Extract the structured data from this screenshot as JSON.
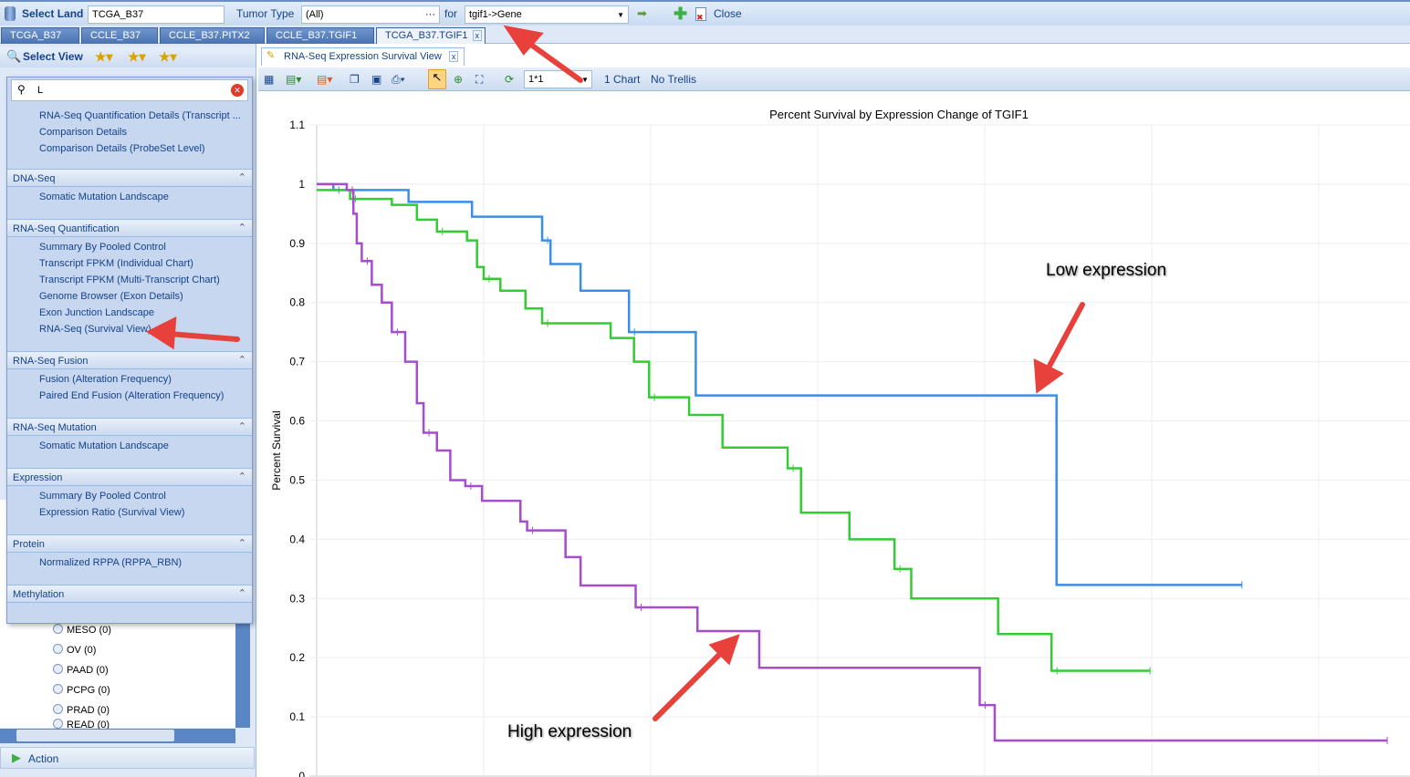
{
  "topbar": {
    "select_land_label": "Select Land",
    "land_value": "TCGA_B37",
    "tumor_type_label": "Tumor Type",
    "tumor_type_value": "(All)",
    "more": "···",
    "for_label": "for",
    "gene_value": "tgif1->Gene",
    "close_label": "Close"
  },
  "tabs": [
    {
      "label": "TCGA_B37"
    },
    {
      "label": "CCLE_B37"
    },
    {
      "label": "CCLE_B37.PITX2"
    },
    {
      "label": "CCLE_B37.TGIF1"
    },
    {
      "label": "TCGA_B37.TGIF1",
      "active": true
    }
  ],
  "left": {
    "select_view_label": "Select View",
    "search_value": "L",
    "top_items": [
      "RNA-Seq Quantification Details (Transcript ...",
      "Comparison Details",
      "Comparison Details (ProbeSet Level)"
    ],
    "sections": [
      {
        "title": "DNA-Seq",
        "items": [
          "Somatic Mutation Landscape"
        ]
      },
      {
        "title": "RNA-Seq Quantification",
        "items": [
          "Summary By Pooled Control",
          "Transcript FPKM (Individual Chart)",
          "Transcript FPKM (Multi-Transcript Chart)",
          "Genome Browser (Exon Details)",
          "Exon Junction Landscape",
          "RNA-Seq (Survival View)"
        ]
      },
      {
        "title": "RNA-Seq Fusion",
        "items": [
          "Fusion (Alteration Frequency)",
          "Paired End Fusion (Alteration Frequency)"
        ]
      },
      {
        "title": "RNA-Seq Mutation",
        "items": [
          "Somatic Mutation Landscape"
        ]
      },
      {
        "title": "Expression",
        "items": [
          "Summary By Pooled Control",
          "Expression Ratio (Survival View)"
        ]
      },
      {
        "title": "Protein",
        "items": [
          "Normalized RPPA (RPPA_RBN)"
        ]
      },
      {
        "title": "Methylation",
        "items": []
      }
    ],
    "tumor_types": [
      "MESO (0)",
      "OV (0)",
      "PAAD (0)",
      "PCPG (0)",
      "PRAD (0)",
      "READ (0)"
    ],
    "action_label": "Action"
  },
  "view": {
    "tab_label": "RNA-Seq Expression Survival View",
    "layout_value": "1*1",
    "chart_count": "1 Chart",
    "trellis": "No Trellis"
  },
  "annotations": {
    "low": "Low expression",
    "high": "High expression",
    "arrow_color": "#e8403a"
  },
  "chart_data": {
    "type": "line",
    "title": "Percent Survival by Expression Change of TGIF1",
    "ylabel": "Percent Survival",
    "xlabel": "",
    "ylim": [
      0,
      1.1
    ],
    "yticks": [
      "0",
      "0.1",
      "0.2",
      "0.3",
      "0.4",
      "0.5",
      "0.6",
      "0.7",
      "0.8",
      "0.9",
      "1",
      "1.1"
    ],
    "grid": true,
    "step": true,
    "series": [
      {
        "color": "#3a8ee6",
        "end": 5.54,
        "points": [
          [
            0,
            1
          ],
          [
            0.1,
            0.99
          ],
          [
            0.55,
            0.97
          ],
          [
            0.93,
            0.945
          ],
          [
            1.35,
            0.905
          ],
          [
            1.4,
            0.865
          ],
          [
            1.58,
            0.82
          ],
          [
            1.87,
            0.75
          ],
          [
            2.27,
            0.643
          ],
          [
            4.43,
            0.323
          ]
        ]
      },
      {
        "color": "#33cc33",
        "end": 4.99,
        "points": [
          [
            0,
            0.99
          ],
          [
            0.2,
            0.975
          ],
          [
            0.45,
            0.965
          ],
          [
            0.6,
            0.94
          ],
          [
            0.72,
            0.92
          ],
          [
            0.9,
            0.905
          ],
          [
            0.96,
            0.86
          ],
          [
            1.0,
            0.84
          ],
          [
            1.1,
            0.82
          ],
          [
            1.25,
            0.79
          ],
          [
            1.35,
            0.765
          ],
          [
            1.76,
            0.74
          ],
          [
            1.9,
            0.7
          ],
          [
            1.99,
            0.64
          ],
          [
            2.23,
            0.61
          ],
          [
            2.43,
            0.555
          ],
          [
            2.82,
            0.52
          ],
          [
            2.9,
            0.445
          ],
          [
            3.19,
            0.4
          ],
          [
            3.46,
            0.35
          ],
          [
            3.56,
            0.3
          ],
          [
            4.08,
            0.24
          ],
          [
            4.4,
            0.178
          ]
        ]
      },
      {
        "color": "#a64ccf",
        "end": 6.41,
        "points": [
          [
            0,
            1
          ],
          [
            0.18,
            0.99
          ],
          [
            0.22,
            0.95
          ],
          [
            0.24,
            0.9
          ],
          [
            0.27,
            0.87
          ],
          [
            0.33,
            0.83
          ],
          [
            0.39,
            0.8
          ],
          [
            0.45,
            0.75
          ],
          [
            0.53,
            0.7
          ],
          [
            0.6,
            0.63
          ],
          [
            0.64,
            0.58
          ],
          [
            0.72,
            0.55
          ],
          [
            0.8,
            0.5
          ],
          [
            0.89,
            0.49
          ],
          [
            0.99,
            0.465
          ],
          [
            1.22,
            0.43
          ],
          [
            1.26,
            0.415
          ],
          [
            1.49,
            0.37
          ],
          [
            1.58,
            0.322
          ],
          [
            1.91,
            0.285
          ],
          [
            2.28,
            0.245
          ],
          [
            2.65,
            0.183
          ],
          [
            3.97,
            0.12
          ],
          [
            4.06,
            0.06
          ]
        ]
      }
    ]
  }
}
